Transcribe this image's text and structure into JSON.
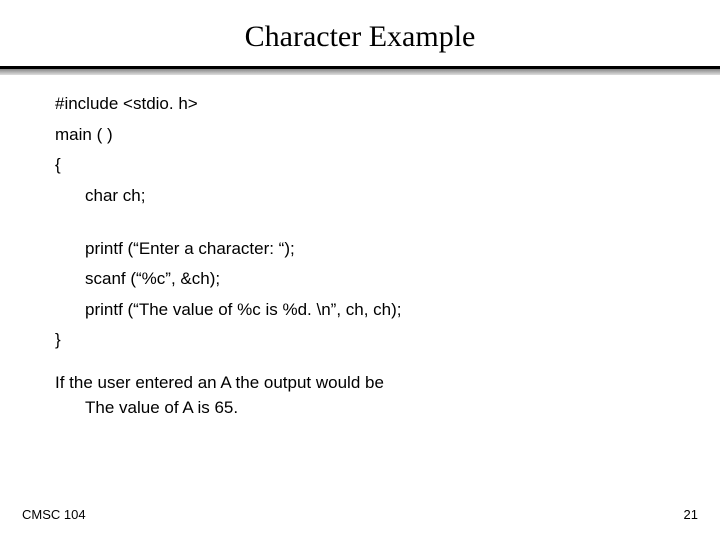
{
  "title": "Character Example",
  "code": {
    "line1": "#include <stdio. h>",
    "line2": "main ( )",
    "line3": "{",
    "line4": "char ch;",
    "line5": "printf (“Enter a character: “);",
    "line6": "scanf (“%c”, &ch);",
    "line7": "printf (“The value of %c is %d. \\n”, ch, ch);",
    "line8": "}"
  },
  "note": {
    "line1": "If the user entered an A the output would be",
    "line2": "The value of A is 65."
  },
  "footer": {
    "left": "CMSC 104",
    "right": "21"
  }
}
